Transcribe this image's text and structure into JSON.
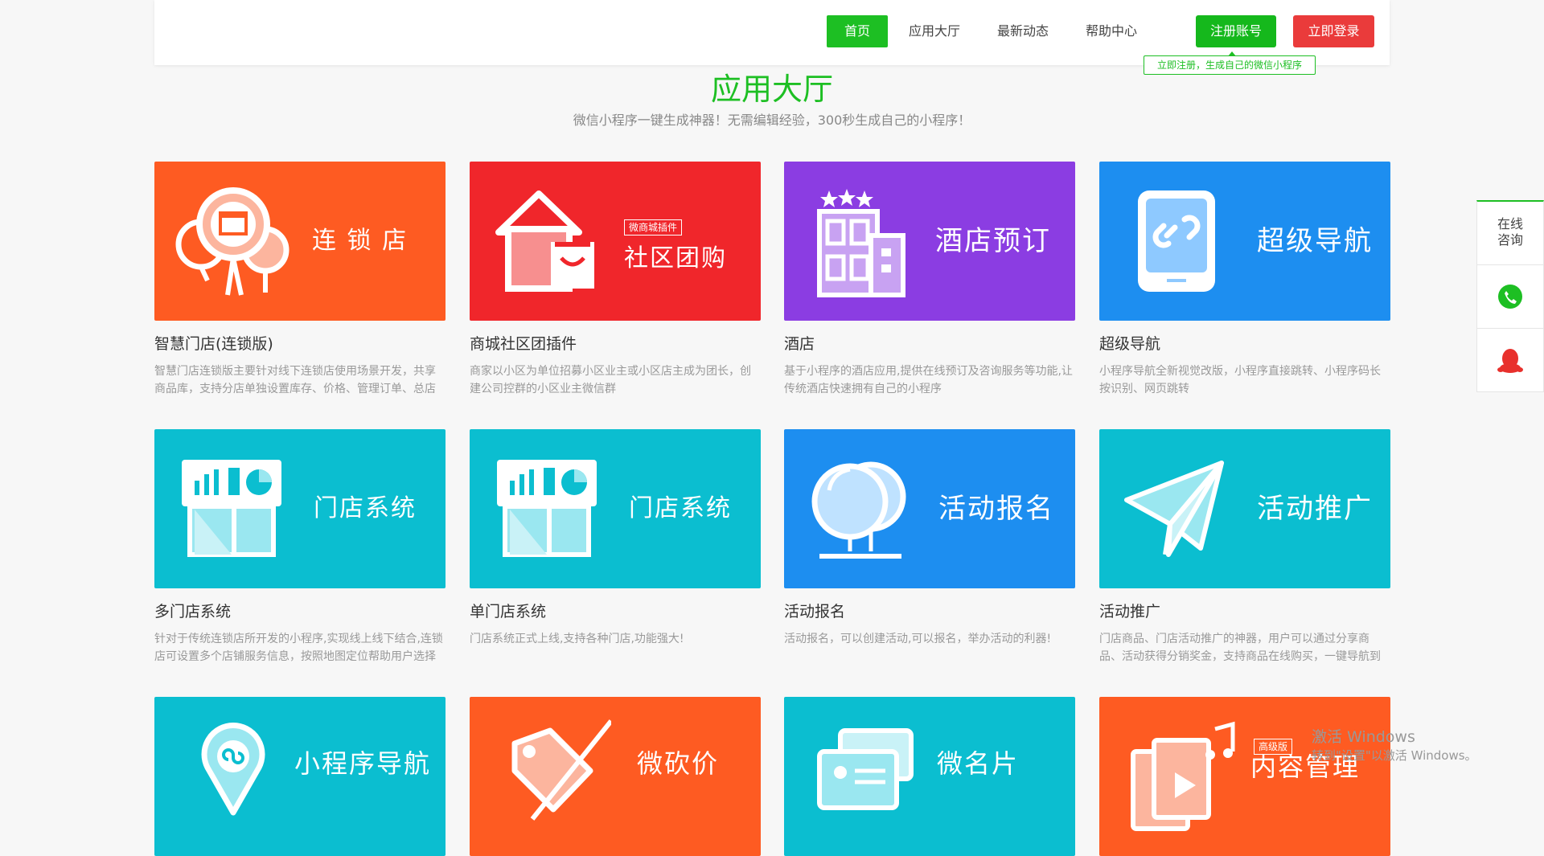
{
  "nav": {
    "items": [
      {
        "label": "首页",
        "active": true
      },
      {
        "label": "应用大厅",
        "active": false
      },
      {
        "label": "最新动态",
        "active": false
      },
      {
        "label": "帮助中心",
        "active": false
      }
    ],
    "register": "注册账号",
    "login": "立即登录",
    "tip": "立即注册，生成自己的微信小程序"
  },
  "page": {
    "title": "应用大厅",
    "subtitle": "微信小程序一键生成神器！无需编辑经验，300秒生成自己的小程序！"
  },
  "cards": [
    {
      "banner_text": "连 锁 店",
      "title": "智慧门店(连锁版)",
      "desc": "智慧门店连锁版主要针对线下连锁店使用场景开发，共享商品库，支持分店单独设置库存、价格、管理订单、总店",
      "color": "#fe5b22",
      "icon": "store-balloons-icon"
    },
    {
      "banner_text": "社区团购",
      "badge": "微商城插件",
      "title": "商城社区团插件",
      "desc": "商家以小区为单位招募小区业主或小区店主成为团长，创建公司控群的小区业主微信群",
      "color": "#f0262b",
      "icon": "house-bag-icon"
    },
    {
      "banner_text": "酒店预订",
      "title": "酒店",
      "desc": "基于小程序的酒店应用,提供在线预订及咨询服务等功能,让传统酒店快速拥有自己的小程序",
      "color": "#8b3de2",
      "icon": "hotel-building-icon"
    },
    {
      "banner_text": "超级导航",
      "title": "超级导航",
      "desc": "小程序导航全新视觉改版，小程序直接跳转、小程序码长按识别、网页跳转",
      "color": "#1d8ef0",
      "icon": "tablet-link-icon"
    },
    {
      "banner_text": "门店系统",
      "title": "多门店系统",
      "desc": "针对于传统连锁店所开发的小程序,实现线上线下结合,连锁店可设置多个店铺服务信息，按照地图定位帮助用户选择",
      "color": "#0bbed0",
      "icon": "store-chart-icon"
    },
    {
      "banner_text": "门店系统",
      "title": "单门店系统",
      "desc": "门店系统正式上线,支持各种门店,功能强大!",
      "color": "#0bbed0",
      "icon": "store-chart-icon"
    },
    {
      "banner_text": "活动报名",
      "title": "活动报名",
      "desc": "活动报名，可以创建活动,可以报名，举办活动的利器!",
      "color": "#1d8ef0",
      "icon": "balloons-icon"
    },
    {
      "banner_text": "活动推广",
      "title": "活动推广",
      "desc": "门店商品、门店活动推广的神器，用户可以通过分享商品、活动获得分销奖金，支持商品在线购买，一键导航到",
      "color": "#0bbed0",
      "icon": "paper-plane-icon"
    },
    {
      "banner_text": "小程序导航",
      "title": "",
      "desc": "",
      "color": "#0bbed0",
      "icon": "map-pin-icon"
    },
    {
      "banner_text": "微砍价",
      "title": "",
      "desc": "",
      "color": "#fe5b22",
      "icon": "price-tag-icon"
    },
    {
      "banner_text": "微名片",
      "title": "",
      "desc": "",
      "color": "#0bbed0",
      "icon": "business-card-icon"
    },
    {
      "banner_text": "内容管理",
      "badge": "高级版",
      "title": "",
      "desc": "",
      "color": "#fe5b22",
      "icon": "media-file-icon"
    }
  ],
  "float": {
    "consult": "在线\n咨询",
    "consult_l1": "在线",
    "consult_l2": "咨询",
    "phone_icon": "phone-icon",
    "qq_icon": "qq-penguin-icon"
  },
  "watermark": {
    "line1": "激活 Windows",
    "line2": "转到\"设置\"以激活 Windows。"
  }
}
